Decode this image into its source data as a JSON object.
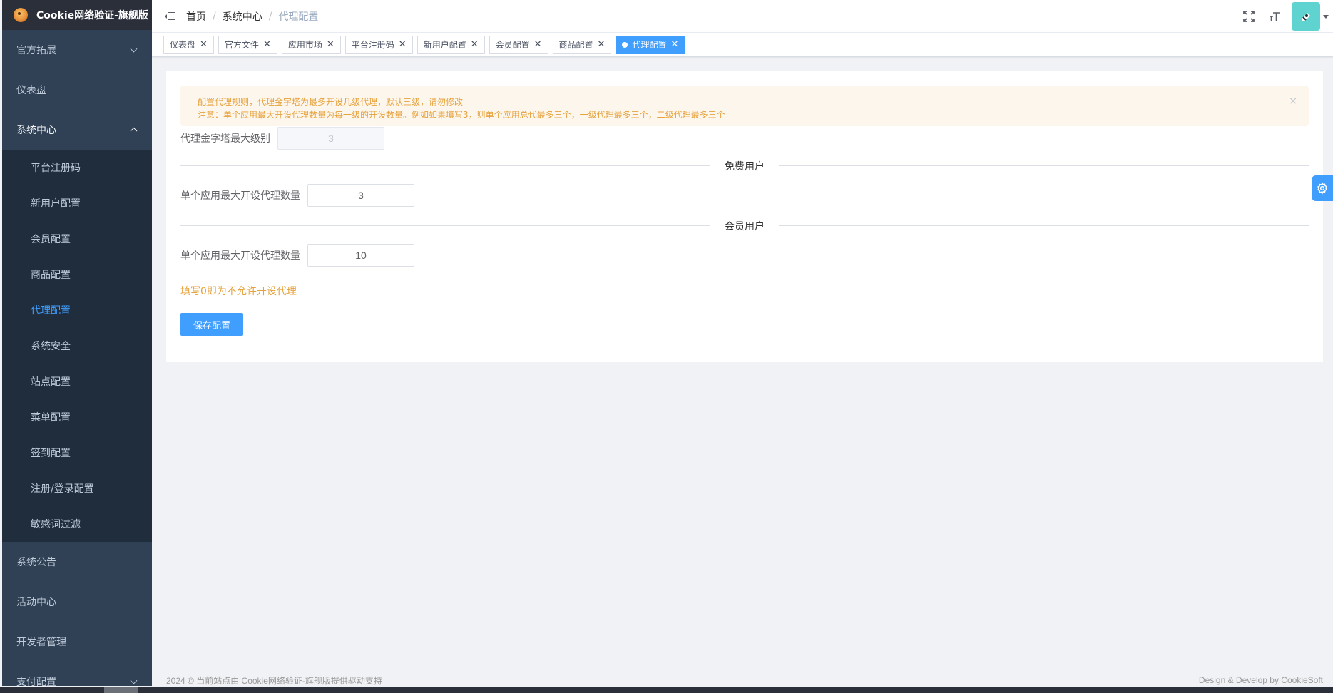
{
  "app": {
    "title": "Cookie网络验证-旗舰版"
  },
  "sidebar": {
    "items": [
      {
        "label": "官方拓展",
        "expandable": true,
        "open": false
      },
      {
        "label": "仪表盘",
        "expandable": false
      },
      {
        "label": "系统中心",
        "expandable": true,
        "open": true
      }
    ],
    "submenu": [
      {
        "label": "平台注册码"
      },
      {
        "label": "新用户配置"
      },
      {
        "label": "会员配置"
      },
      {
        "label": "商品配置"
      },
      {
        "label": "代理配置",
        "active": true
      },
      {
        "label": "系统安全"
      },
      {
        "label": "站点配置"
      },
      {
        "label": "菜单配置"
      },
      {
        "label": "签到配置"
      },
      {
        "label": "注册/登录配置"
      },
      {
        "label": "敏感词过滤"
      }
    ],
    "items_after": [
      {
        "label": "系统公告"
      },
      {
        "label": "活动中心"
      },
      {
        "label": "开发者管理"
      },
      {
        "label": "支付配置",
        "expandable": true
      }
    ]
  },
  "header": {
    "breadcrumb": [
      "首页",
      "系统中心",
      "代理配置"
    ],
    "separator": "/",
    "icons": [
      "fullscreen-icon",
      "font-size-icon"
    ]
  },
  "tags": [
    {
      "label": "仪表盘"
    },
    {
      "label": "官方文件"
    },
    {
      "label": "应用市场"
    },
    {
      "label": "平台注册码"
    },
    {
      "label": "新用户配置"
    },
    {
      "label": "会员配置"
    },
    {
      "label": "商品配置"
    },
    {
      "label": "代理配置",
      "active": true
    }
  ],
  "alert": {
    "line1": "配置代理规则，代理金字塔为最多开设几级代理，默认三级，请勿修改",
    "line2": "注意：单个应用最大开设代理数量为每一级的开设数量。例如如果填写3，则单个应用总代最多三个，一级代理最多三个，二级代理最多三个",
    "close": "×"
  },
  "form": {
    "pyramid_label": "代理金字塔最大级别",
    "pyramid_value": "3",
    "free_divider": "免费用户",
    "free_label": "单个应用最大开设代理数量",
    "free_value": "3",
    "member_divider": "会员用户",
    "member_label": "单个应用最大开设代理数量",
    "member_value": "10",
    "hint": "填写0即为不允许开设代理",
    "save_label": "保存配置"
  },
  "footer": {
    "left": "2024 © 当前站点由 Cookie网络验证-旗舰版提供驱动支持",
    "right": "Design & Develop by CookieSoft"
  },
  "colors": {
    "sidebar_bg": "#304156",
    "submenu_bg": "#1f2d3d",
    "accent": "#409eff",
    "warning": "#e6a23c",
    "avatar_bg": "#5fd3cf"
  }
}
